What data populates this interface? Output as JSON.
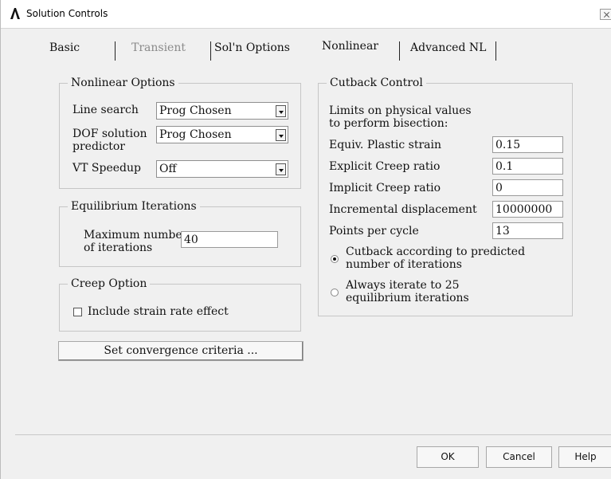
{
  "window": {
    "title": "Solution Controls"
  },
  "tabs": [
    {
      "label": "Basic"
    },
    {
      "label": "Transient"
    },
    {
      "label": "Sol'n Options"
    },
    {
      "label": "Nonlinear"
    },
    {
      "label": "Advanced NL"
    }
  ],
  "nonlinear_options": {
    "title": "Nonlinear Options",
    "line_search": {
      "label": "Line search",
      "value": "Prog Chosen"
    },
    "dof_predictor": {
      "label_line1": "DOF solution",
      "label_line2": "predictor",
      "value": "Prog Chosen"
    },
    "vt_speedup": {
      "label": "VT Speedup",
      "value": "Off"
    }
  },
  "equilibrium": {
    "title": "Equilibrium Iterations",
    "max_label_line1": "Maximum number",
    "max_label_line2": "of iterations",
    "max_value": "40"
  },
  "creep": {
    "title": "Creep Option",
    "include_label": "Include strain rate effect",
    "include_checked": false
  },
  "convergence_button": "Set convergence criteria ...",
  "cutback": {
    "title": "Cutback Control",
    "intro_line1": "Limits on physical values",
    "intro_line2": "to perform bisection:",
    "fields": [
      {
        "label": "Equiv. Plastic strain",
        "value": "0.15"
      },
      {
        "label": "Explicit Creep ratio",
        "value": "0.1"
      },
      {
        "label": "Implicit Creep ratio",
        "value": "0"
      },
      {
        "label": "Incremental displacement",
        "value": "10000000"
      },
      {
        "label": "Points per cycle",
        "value": "13"
      }
    ],
    "option_predicted_line1": "Cutback according to predicted",
    "option_predicted_line2": "number of iterations",
    "option_always_line1": "Always iterate to 25",
    "option_always_line2": "equilibrium iterations",
    "selected_option": "predicted"
  },
  "buttons": {
    "ok": "OK",
    "cancel": "Cancel",
    "help": "Help"
  }
}
